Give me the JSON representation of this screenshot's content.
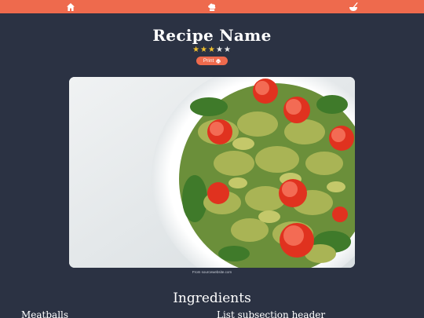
{
  "colors": {
    "background": "#2b3243",
    "accent": "#ee6a4d",
    "star_on": "#f2c12e",
    "star_off": "#e8e8e8"
  },
  "nav": {
    "items": [
      {
        "icon": "home-icon"
      },
      {
        "icon": "chef-hat-icon"
      },
      {
        "icon": "mixing-bowl-icon"
      }
    ]
  },
  "recipe": {
    "title": "Recipe Name",
    "rating": {
      "value": 3,
      "max": 5
    },
    "print_label": "Print",
    "print_icon": "printer-icon",
    "image_caption": "From sourcewebsite.com"
  },
  "ingredients": {
    "title": "Ingredients",
    "subsections": [
      "Meatballs",
      "List subsection header"
    ]
  }
}
